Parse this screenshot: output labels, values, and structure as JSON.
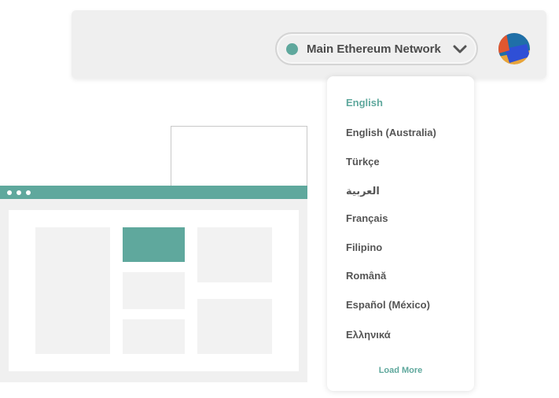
{
  "header": {
    "network_label": "Main Ethereum Network",
    "network_status_color": "#5fa89d",
    "dropdown_icon": "chevron-down-icon",
    "avatar_icon": "account-avatar"
  },
  "language_menu": {
    "items": [
      {
        "label": "English",
        "selected": true
      },
      {
        "label": "English (Australia)",
        "selected": false
      },
      {
        "label": "Türkçe",
        "selected": false
      },
      {
        "label": "العربية",
        "selected": false
      },
      {
        "label": "Français",
        "selected": false
      },
      {
        "label": "Filipino",
        "selected": false
      },
      {
        "label": "Română",
        "selected": false
      },
      {
        "label": "Español (México)",
        "selected": false
      },
      {
        "label": "Ελληνικά",
        "selected": false
      }
    ],
    "load_more": "Load More"
  },
  "colors": {
    "accent": "#5fa89d",
    "panel": "#efefef",
    "placeholder": "#f2f2f2"
  }
}
